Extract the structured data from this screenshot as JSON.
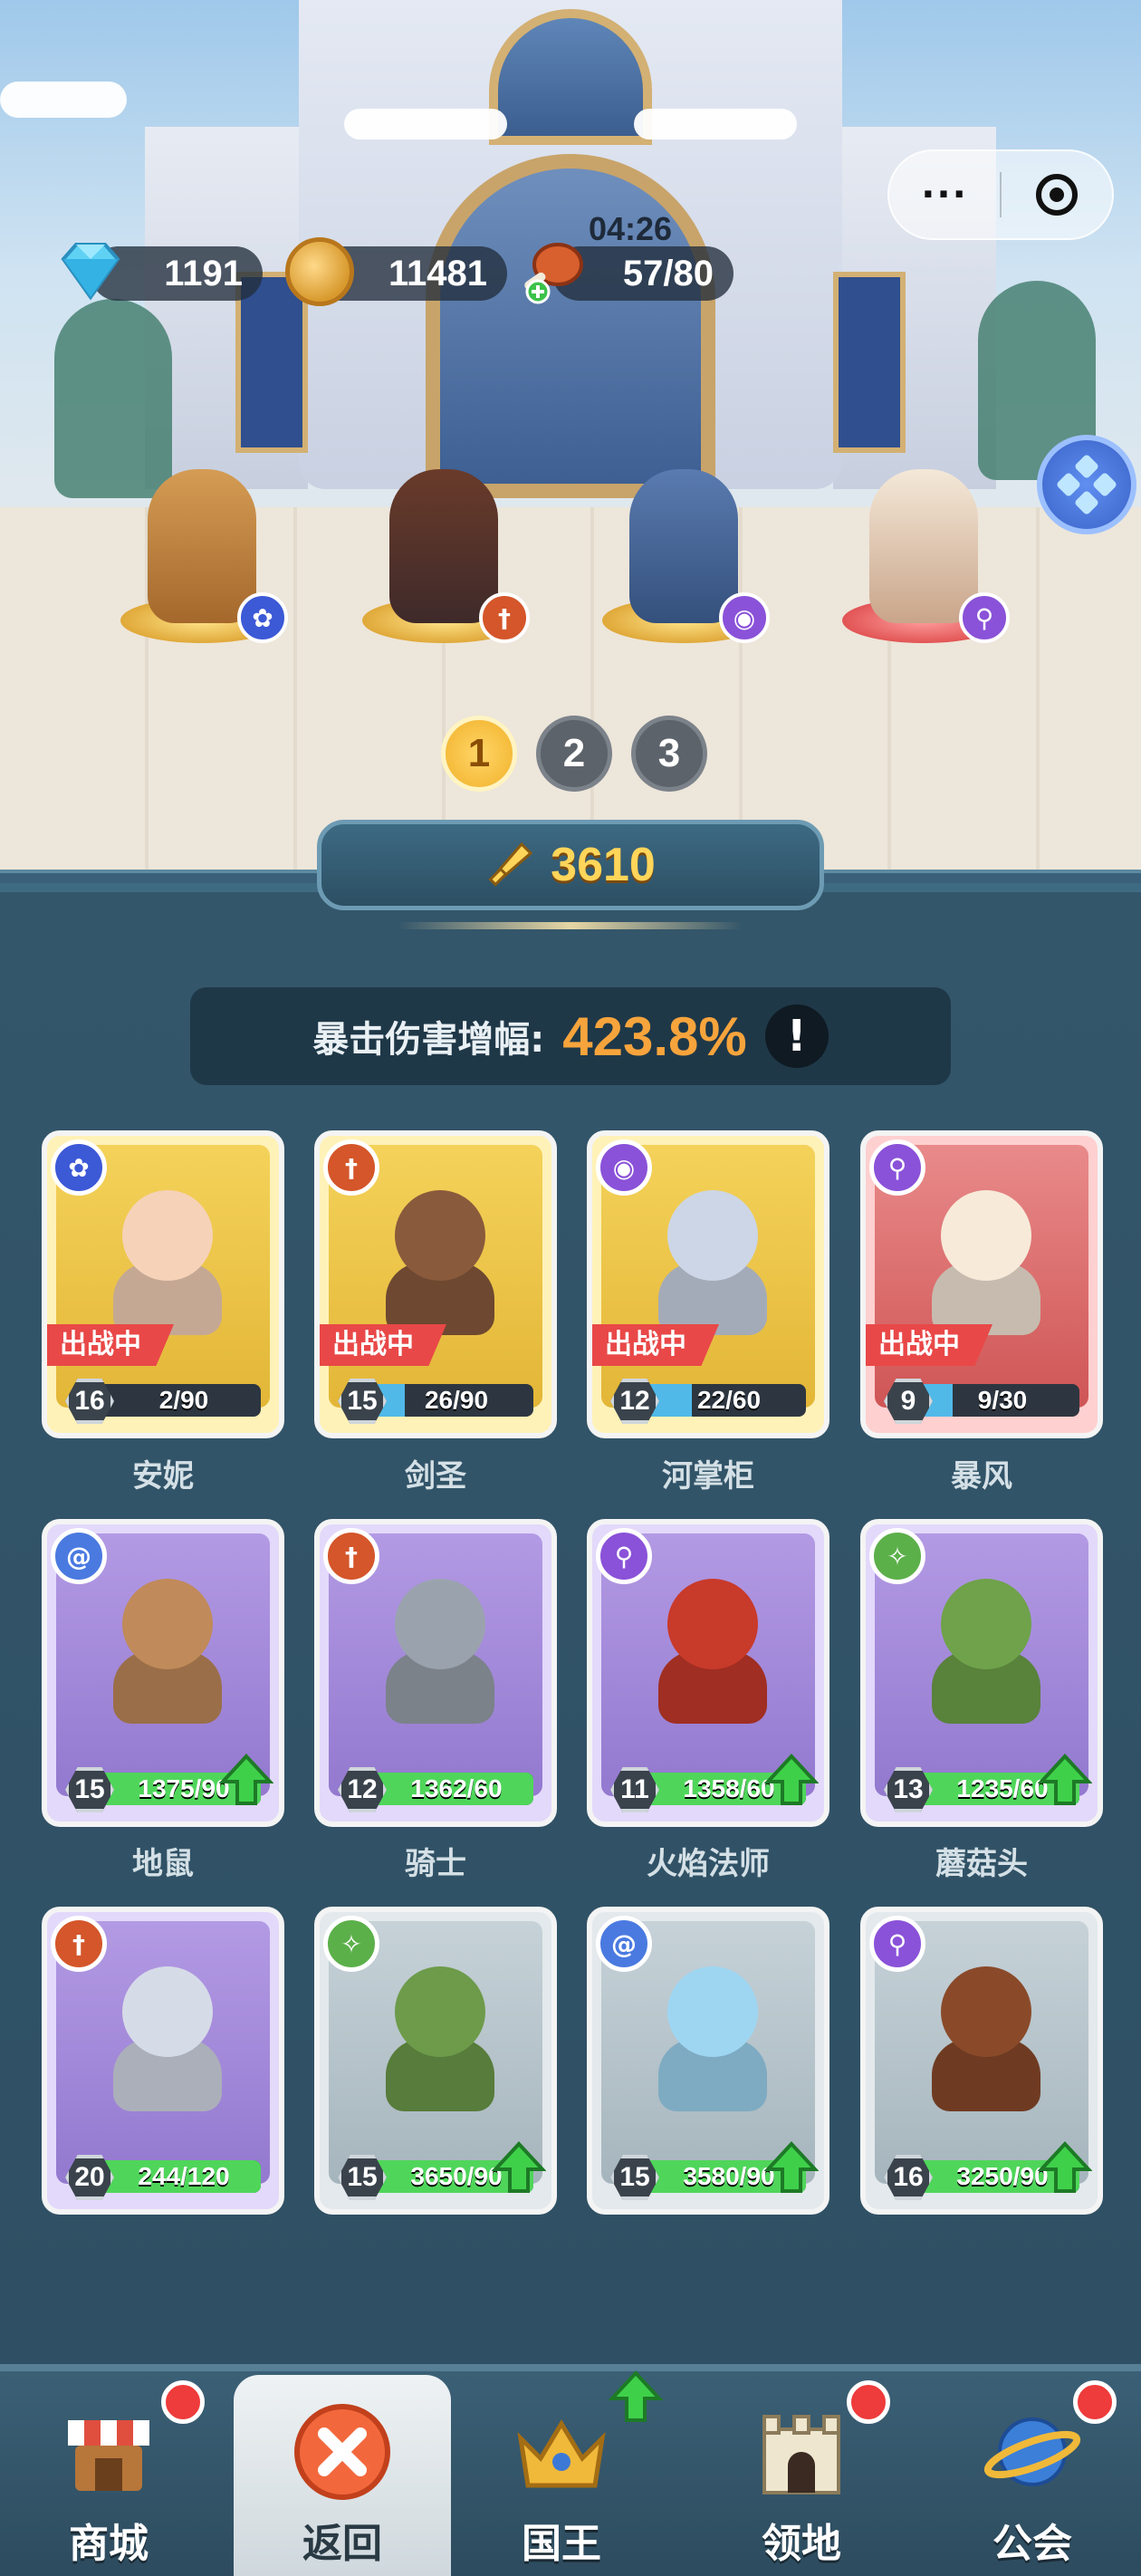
{
  "top_bar": {
    "gems": "1191",
    "coins": "11481",
    "stamina": "57/80",
    "stamina_timer": "04:26",
    "menu_dots": "···",
    "icons": [
      "gem-icon",
      "coin-icon",
      "meat-icon",
      "target-icon"
    ]
  },
  "team_pager": [
    "1",
    "2",
    "3"
  ],
  "active_team": "1",
  "power": "3610",
  "crit": {
    "label": "暴击伤害增幅:",
    "value": "423.8%",
    "info_symbol": "!"
  },
  "deployed_tag": "出战中",
  "heroes": [
    {
      "name": "安妮",
      "level": "16",
      "progress": "2/90",
      "progress_fraction": 0.02,
      "frame": "gold",
      "role_color": "#3c59d6",
      "deployed": true
    },
    {
      "name": "剑圣",
      "level": "15",
      "progress": "26/90",
      "progress_fraction": 0.29,
      "frame": "gold",
      "role_color": "#d4562a",
      "deployed": true
    },
    {
      "name": "河掌柜",
      "level": "12",
      "progress": "22/60",
      "progress_fraction": 0.37,
      "frame": "gold",
      "role_color": "#8a52d8",
      "deployed": true
    },
    {
      "name": "暴风",
      "level": "9",
      "progress": "9/30",
      "progress_fraction": 0.3,
      "frame": "red",
      "role_color": "#8a52d8",
      "deployed": true
    },
    {
      "name": "地鼠",
      "level": "15",
      "progress": "1375/90",
      "progress_fraction": 1.0,
      "frame": "purple",
      "role_color": "#4a7ae0",
      "deployed": false,
      "upgradable": true
    },
    {
      "name": "骑士",
      "level": "12",
      "progress": "1362/60",
      "progress_fraction": 1.0,
      "frame": "purple",
      "role_color": "#d4562a",
      "deployed": false,
      "upgradable": false
    },
    {
      "name": "火焰法师",
      "level": "11",
      "progress": "1358/60",
      "progress_fraction": 1.0,
      "frame": "purple",
      "role_color": "#8a52d8",
      "deployed": false,
      "upgradable": true
    },
    {
      "name": "蘑菇头",
      "level": "13",
      "progress": "1235/60",
      "progress_fraction": 1.0,
      "frame": "purple",
      "role_color": "#5cb04a",
      "deployed": false,
      "upgradable": true
    },
    {
      "name": "",
      "level": "20",
      "progress": "244/120",
      "progress_fraction": 1.0,
      "frame": "purple",
      "role_color": "#d4562a",
      "deployed": false,
      "upgradable": false
    },
    {
      "name": "",
      "level": "15",
      "progress": "3650/90",
      "progress_fraction": 1.0,
      "frame": "grey",
      "role_color": "#5cb04a",
      "deployed": false,
      "upgradable": true
    },
    {
      "name": "",
      "level": "15",
      "progress": "3580/90",
      "progress_fraction": 1.0,
      "frame": "grey",
      "role_color": "#4a7ae0",
      "deployed": false,
      "upgradable": true
    },
    {
      "name": "",
      "level": "16",
      "progress": "3250/90",
      "progress_fraction": 1.0,
      "frame": "grey",
      "role_color": "#8a52d8",
      "deployed": false,
      "upgradable": true
    }
  ],
  "nav": [
    {
      "label": "商城",
      "icon": "shop-icon",
      "badge": true
    },
    {
      "label": "返回",
      "icon": "close-icon",
      "active": true
    },
    {
      "label": "国王",
      "icon": "crown-icon",
      "arrow": true
    },
    {
      "label": "领地",
      "icon": "castle-icon",
      "badge": true
    },
    {
      "label": "公会",
      "icon": "planet-icon",
      "badge": true
    }
  ],
  "colors": {
    "accent_gold": "#ffd55a",
    "crit_orange": "#f7a43c",
    "progress_green": "#4fd65a",
    "progress_blue": "#51b9e8",
    "deployed_red": "#e94848",
    "badge_red": "#ee3b3b"
  }
}
